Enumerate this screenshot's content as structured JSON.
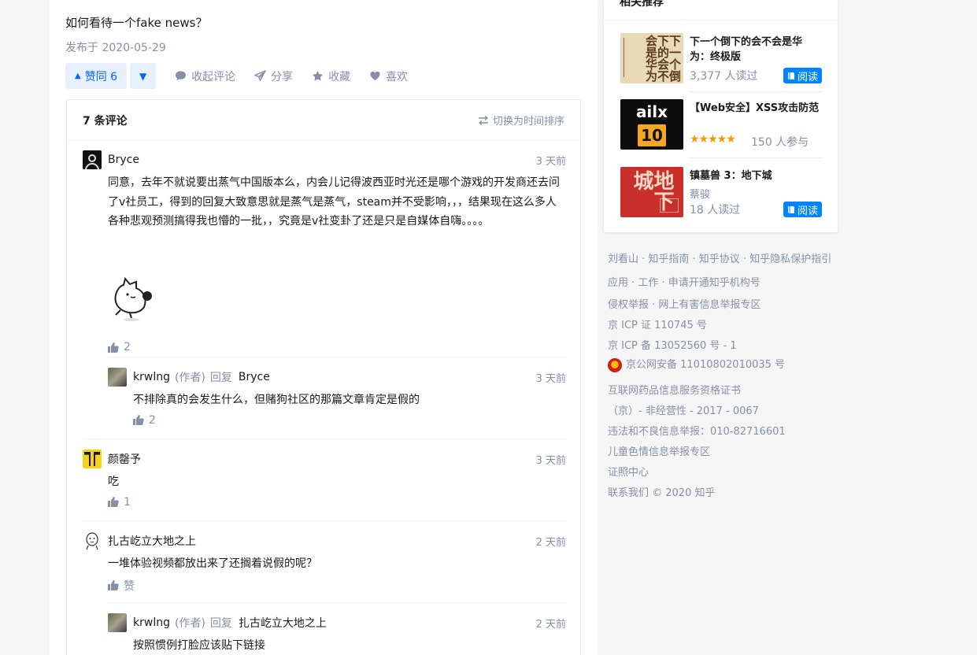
{
  "question": {
    "title": "如何看待一个fake news？",
    "published": "发布于 2020-05-29"
  },
  "actions": {
    "upvote": "赞同 6",
    "collapse_comments": "收起评论",
    "share": "分享",
    "favorite": "收藏",
    "like": "喜欢"
  },
  "comments": {
    "count_title": "7 条评论",
    "sort_toggle": "切换为时间排序",
    "items": [
      {
        "user": "Bryce",
        "time": "3 天前",
        "text": "同意，去年不就说要出蒸气中国版本么，内会儿记得波西亚时光还是哪个游戏的开发商还去问了v社员工，得到的回复大致意思就是蒸气是蒸气，steam并不受影响，，，结果现在这么多人各种悲观预测搞得我也懵的一批，，究竟是v社变卦了还是只是自媒体自嗨。。。。",
        "likes": "2"
      },
      {
        "user": "krwlng",
        "author_tag": "(作者)",
        "reply_kw": "回复",
        "reply_to": "Bryce",
        "time": "3 天前",
        "text": "不排除真的会发生什么，但赌狗社区的那篇文章肯定是假的",
        "likes": "2"
      },
      {
        "user": "颜罄予",
        "time": "3 天前",
        "text": "吃",
        "likes": "1"
      },
      {
        "user": "扎古屹立大地之上",
        "time": "2 天前",
        "text": "一堆体验视频都放出来了还搁着说假的呢？",
        "likes": "赞"
      },
      {
        "user": "krwlng",
        "author_tag": "(作者)",
        "reply_kw": "回复",
        "reply_to": "扎古屹立大地之上",
        "time": "2 天前",
        "text": "按照惯例打脸应该贴下链接"
      }
    ]
  },
  "sidebar": {
    "title": "相关推荐",
    "recommendations": [
      {
        "title": "下一个倒下的会不会是华为：终极版",
        "stat": "3,377 人读过",
        "button": "阅读",
        "cover_text": "下一个倒下的会不会是华为"
      },
      {
        "title": "【Web安全】XSS攻击防范",
        "stars": "★★★★★",
        "stat": "150 人参与",
        "cover_text_1": "ailx",
        "cover_text_2": "10"
      },
      {
        "title": "镇墓兽 3：地下城",
        "author": "蔡骏",
        "stat": "18 人读过",
        "button": "阅读",
        "cover_text": "地下城"
      }
    ],
    "footer": [
      "刘看山 · 知乎指南 · 知乎协议 · 知乎隐私保护指引",
      "应用 · 工作 · 申请开通知乎机构号",
      "侵权举报 · 网上有害信息举报专区",
      "京 ICP 证 110745 号",
      "京 ICP 备 13052560 号 - 1",
      "京公网安备 11010802010035 号",
      "互联网药品信息服务资格证书",
      "（京）- 非经营性 - 2017 - 0067",
      "违法和不良信息举报：010-82716601",
      "儿童色情信息举报专区",
      "证照中心",
      "联系我们 © 2020 知乎"
    ]
  },
  "colors": {
    "brand_blue": "#0066ff",
    "read_button": "#0084ff",
    "meta_gray": "#8590a6",
    "star": "#f09a00"
  }
}
